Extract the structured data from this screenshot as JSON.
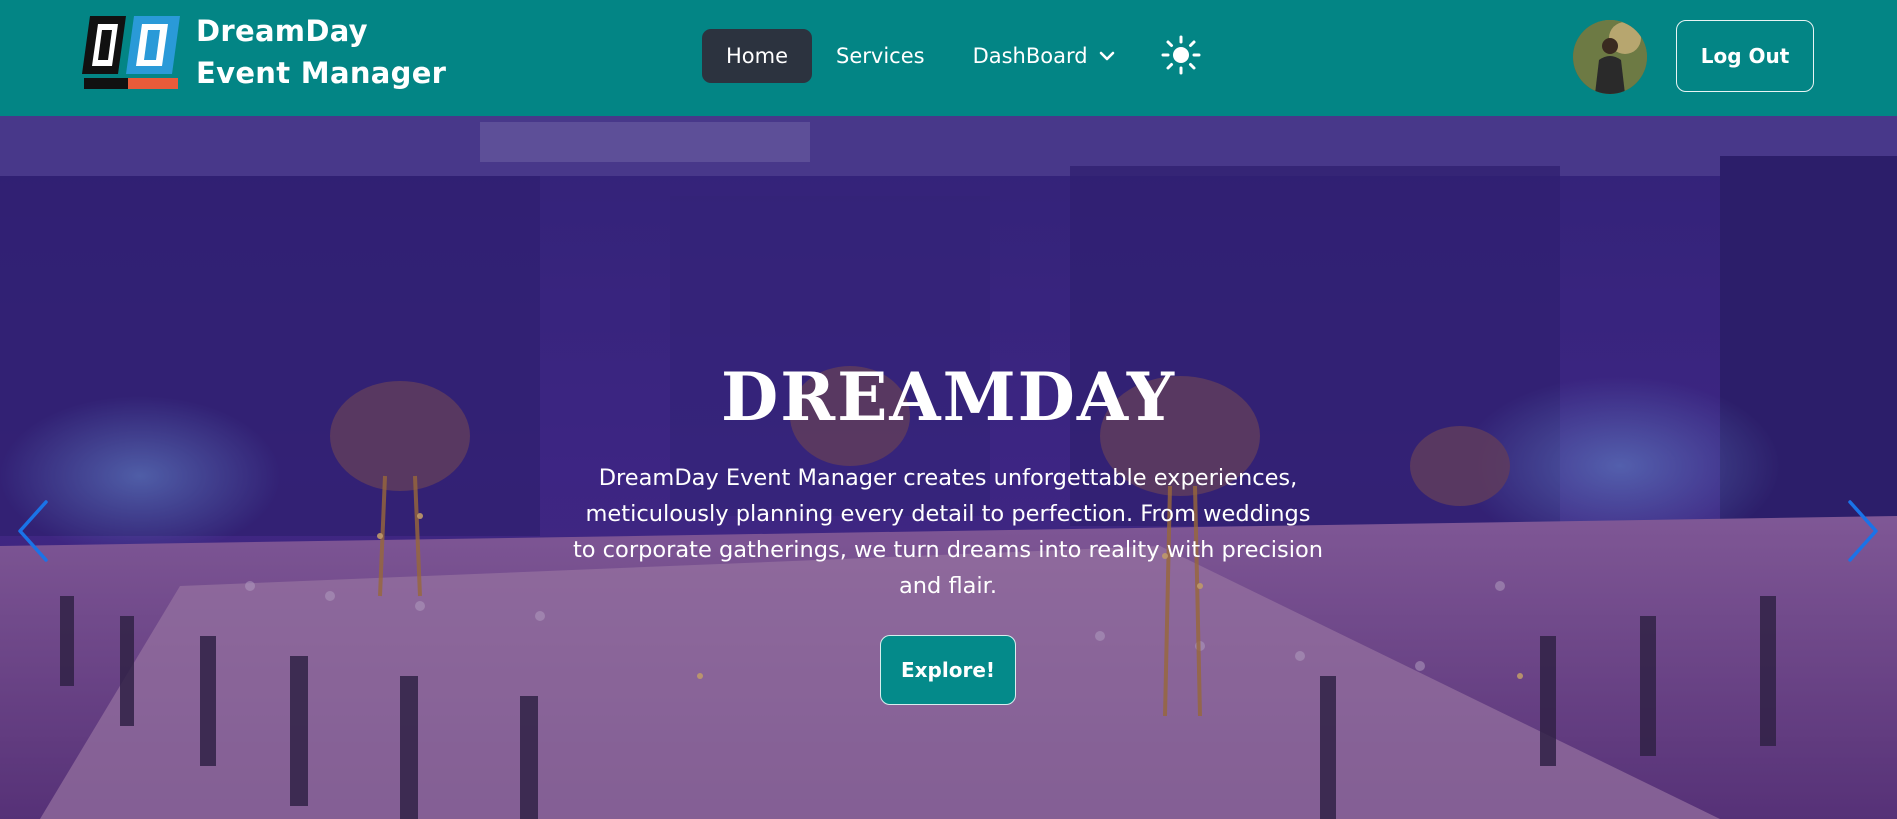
{
  "brand": {
    "line1": "DreamDay",
    "line2": "Event Manager",
    "logo_letters": "DD",
    "logo_caption": "EVENT MANAGER"
  },
  "nav": {
    "links": [
      {
        "label": "Home",
        "active": true
      },
      {
        "label": "Services",
        "active": false
      },
      {
        "label": "DashBoard",
        "active": false
      }
    ],
    "theme_icon": "sun-icon",
    "dropdown_icon": "chevron-down-icon"
  },
  "user": {
    "avatar": "user-avatar",
    "logout_label": "Log Out"
  },
  "hero": {
    "title": "DREAMDAY",
    "description": "DreamDay Event Manager creates unforgettable experiences, meticulously planning every detail to perfection. From weddings to corporate gatherings, we turn dreams into reality with precision and flair.",
    "button_label": "Explore!",
    "prev_icon": "chevron-left-icon",
    "next_icon": "chevron-right-icon"
  },
  "colors": {
    "navbar": "#038585",
    "active_tab": "#2c333f",
    "button": "#048a8a",
    "carousel_arrows": "#1a73e8"
  }
}
